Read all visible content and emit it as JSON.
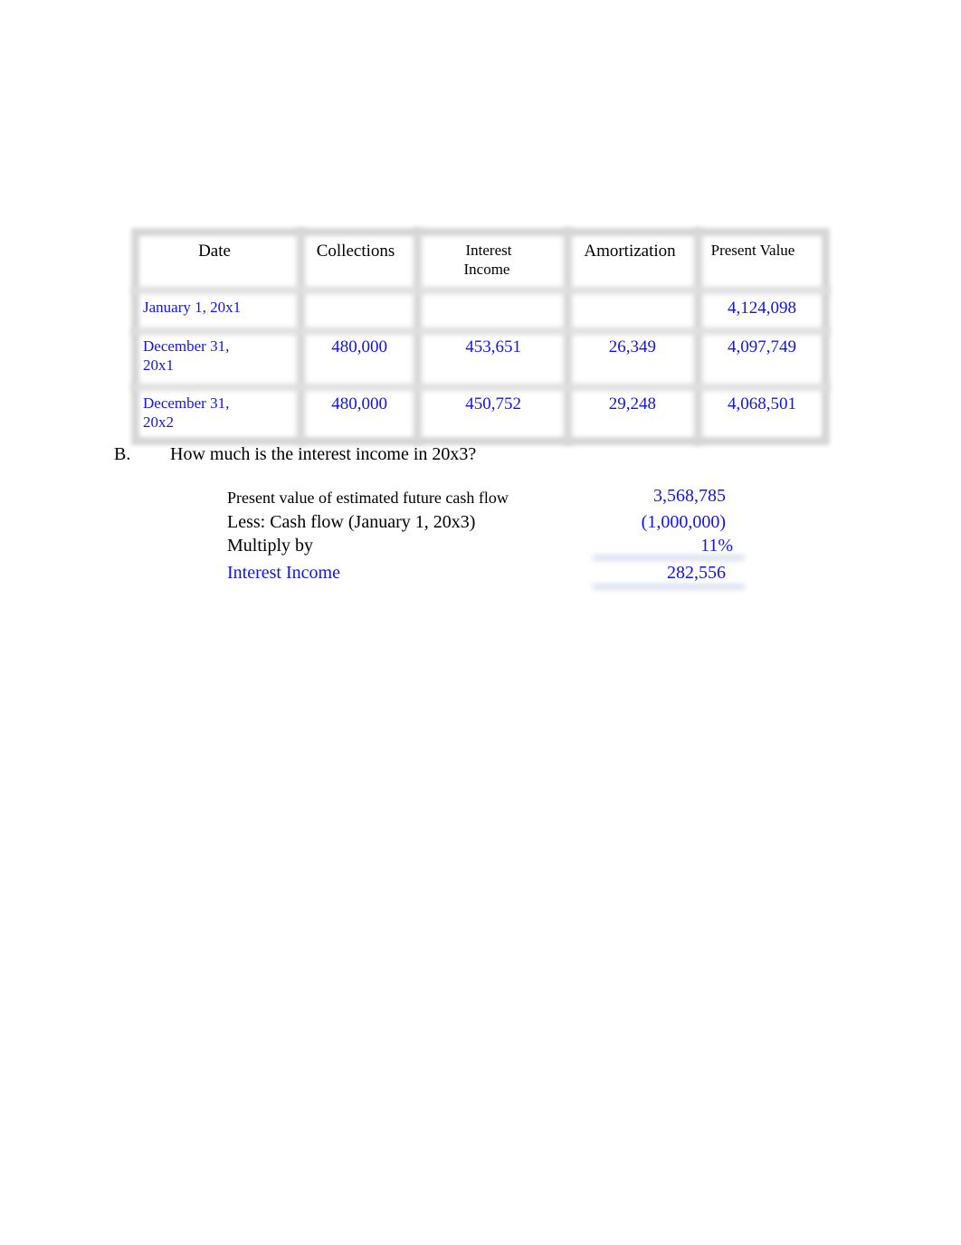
{
  "table": {
    "headers": {
      "date": "Date",
      "collections": "Collections",
      "interest_line1": "Interest",
      "interest_line2": "Income",
      "amortization": "Amortization",
      "present_value": "Present Value"
    },
    "rows": [
      {
        "date_line1": "January 1, 20x1",
        "date_line2": "",
        "collections": "",
        "interest_income": "",
        "amortization": "",
        "present_value": "4,124,098"
      },
      {
        "date_line1": "December 31,",
        "date_line2": "20x1",
        "collections": "480,000",
        "interest_income": "453,651",
        "amortization": "26,349",
        "present_value": "4,097,749"
      },
      {
        "date_line1": "December 31,",
        "date_line2": "20x2",
        "collections": "480,000",
        "interest_income": "450,752",
        "amortization": "29,248",
        "present_value": "4,068,501"
      }
    ]
  },
  "question": {
    "letter": "B.",
    "text": "How much is the interest income in 20x3?"
  },
  "computation": {
    "rows": [
      {
        "label": "Present value of estimated future cash flow",
        "value": "3,568,785"
      },
      {
        "label": "Less: Cash flow (January 1, 20x3)",
        "value": "(1,000,000)"
      },
      {
        "label": "Multiply by",
        "value": "11%"
      },
      {
        "label": "Interest Income",
        "value": "282,556"
      }
    ]
  },
  "colors": {
    "answer_blue": "#1414e6",
    "text_black": "#000000",
    "border_gray": "#d6d6d6"
  }
}
